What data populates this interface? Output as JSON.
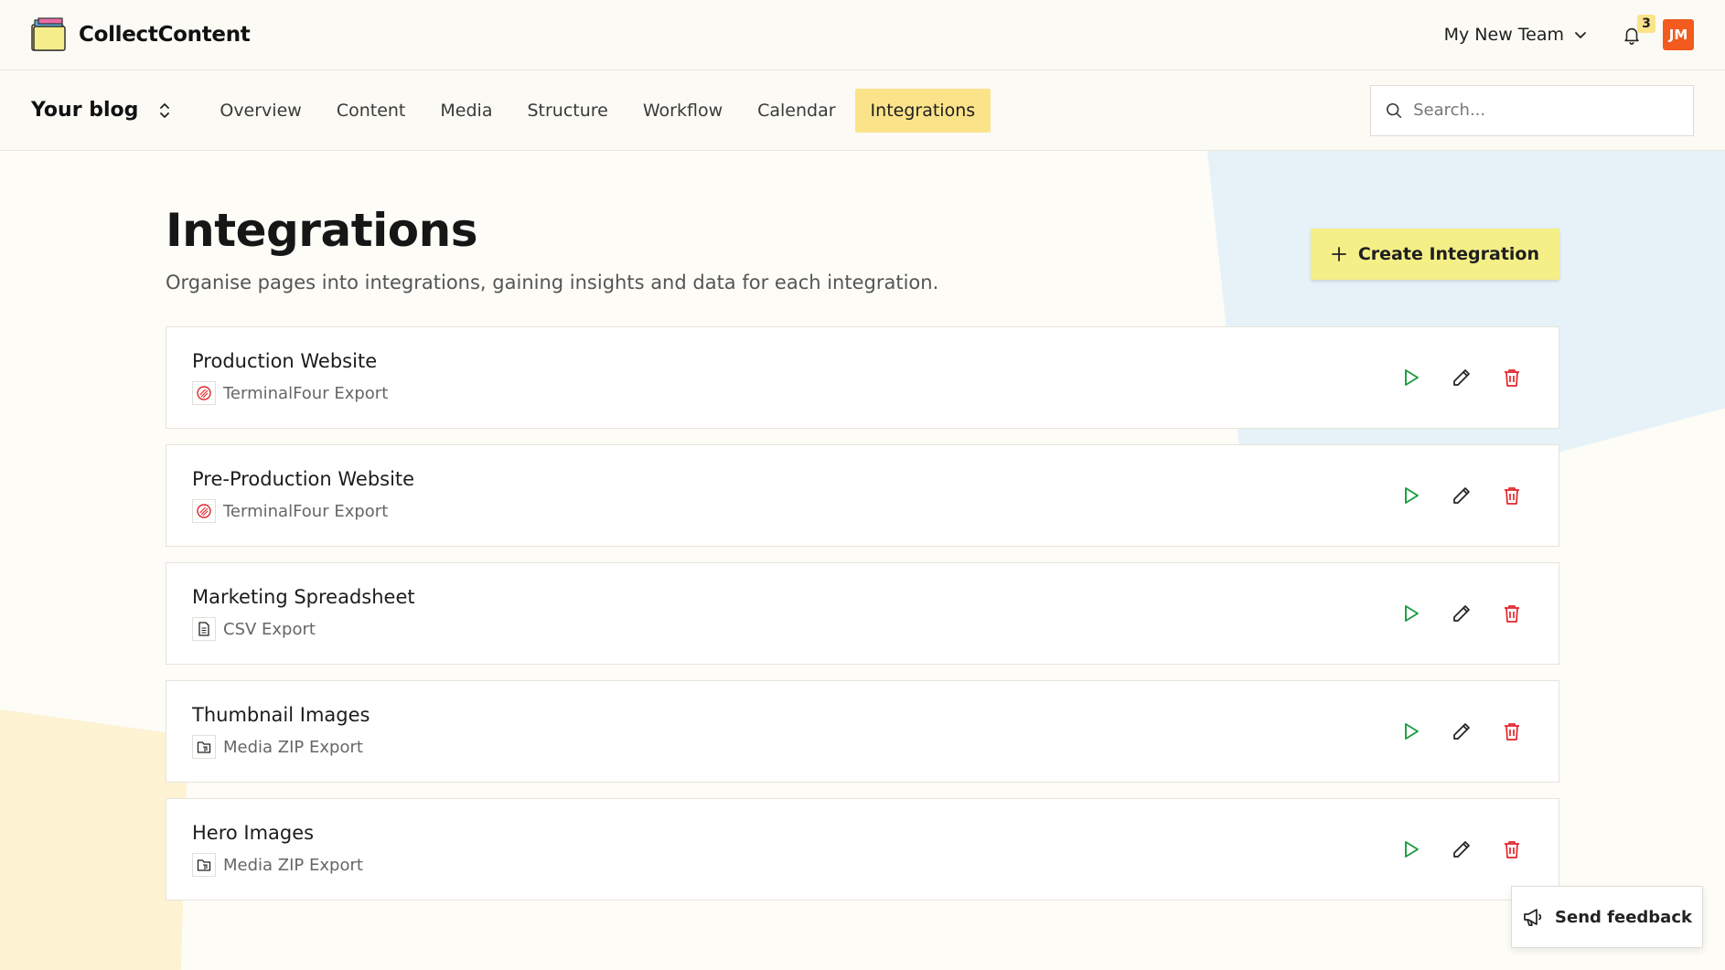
{
  "brand": {
    "name": "CollectContent"
  },
  "header": {
    "team": "My New Team",
    "notification_count": "3",
    "avatar_initials": "JM"
  },
  "nav": {
    "project": "Your blog",
    "tabs": [
      {
        "label": "Overview"
      },
      {
        "label": "Content"
      },
      {
        "label": "Media"
      },
      {
        "label": "Structure"
      },
      {
        "label": "Workflow"
      },
      {
        "label": "Calendar"
      },
      {
        "label": "Integrations",
        "active": true
      }
    ],
    "search_placeholder": "Search..."
  },
  "page": {
    "title": "Integrations",
    "description": "Organise pages into integrations, gaining insights and data for each integration.",
    "create_label": "Create Integration"
  },
  "integrations": [
    {
      "name": "Production Website",
      "type": "TerminalFour Export",
      "icon": "terminalfour-icon"
    },
    {
      "name": "Pre-Production Website",
      "type": "TerminalFour Export",
      "icon": "terminalfour-icon"
    },
    {
      "name": "Marketing Spreadsheet",
      "type": "CSV Export",
      "icon": "csv-file-icon"
    },
    {
      "name": "Thumbnail Images",
      "type": "Media ZIP Export",
      "icon": "media-folder-icon"
    },
    {
      "name": "Hero Images",
      "type": "Media ZIP Export",
      "icon": "media-folder-icon"
    }
  ],
  "feedback": {
    "label": "Send feedback"
  },
  "colors": {
    "accent_yellow": "#fbe38a",
    "button_yellow": "#f4ef87",
    "run_green": "#1a9c3f",
    "delete_red": "#e0252b",
    "avatar_orange": "#f25a1e"
  }
}
